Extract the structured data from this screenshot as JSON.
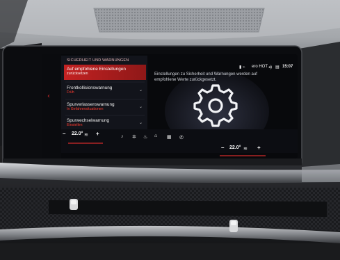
{
  "header_title": "SICHERHEIT UND WARNUNGEN",
  "menu": [
    {
      "title": "Auf empfohlene Einstellungen",
      "subtitle": "zurücksetzen",
      "selected": true
    },
    {
      "title": "Frontkollisionswarnung",
      "subtitle": "Früh",
      "selected": false
    },
    {
      "title": "Spurverlassenswarnung",
      "subtitle": "In Gefahrensituationen",
      "selected": false
    },
    {
      "title": "Spurwechselwarnung",
      "subtitle": "Einstellen",
      "selected": false
    }
  ],
  "info_text": "Einstellungen zu Sicherheit und Warnungen werden auf empfohlene Werte zurückgesetzt.",
  "status": {
    "profile": "ero HOT",
    "time": "15:07"
  },
  "climate": {
    "left_temp": "22.0°",
    "right_temp": "22.0°",
    "minus": "–",
    "plus": "+"
  },
  "icons": {
    "back": "chevron-left-icon",
    "settings": "gear-icon",
    "music": "music-note-icon",
    "home": "home-icon",
    "apps": "grid-icon",
    "phone": "phone-icon",
    "fan": "fan-icon",
    "seat_heat": "seat-heat-icon",
    "volume": "speaker-icon"
  },
  "colors": {
    "accent_red": "#d32b2b",
    "screen_bg": "#08090c",
    "panel_bg": "#13151d"
  }
}
